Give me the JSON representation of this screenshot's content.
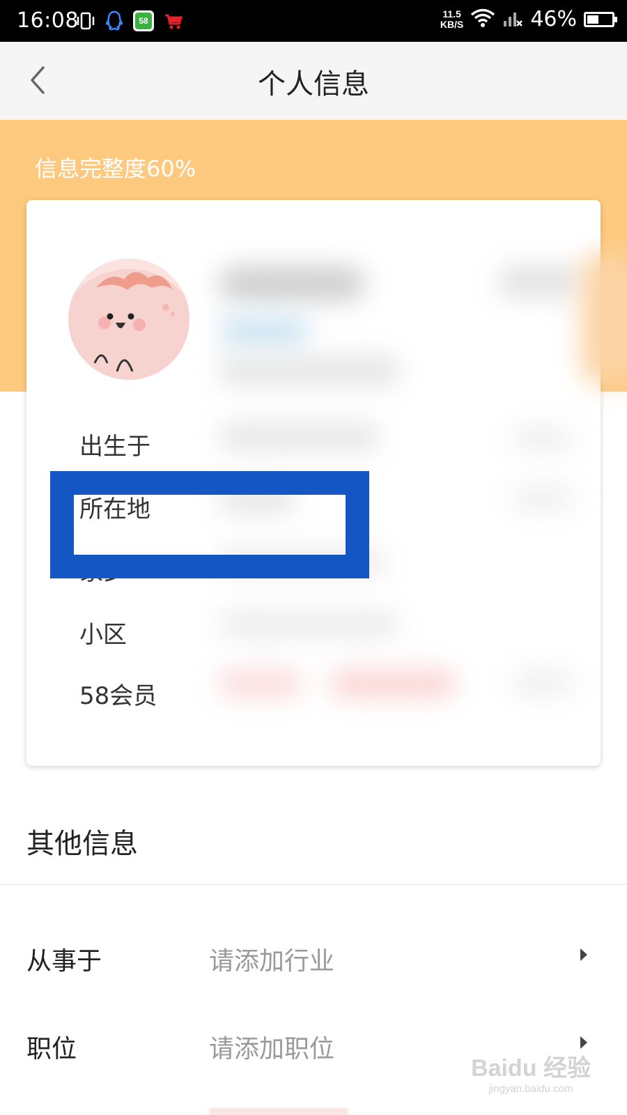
{
  "status_bar": {
    "time": "16:08",
    "net_speed_value": "11.5",
    "net_speed_unit": "KB/S",
    "battery": "46%",
    "battery_level": 0.46,
    "icons": [
      "vibrate-icon",
      "qq-icon",
      "app-58-icon",
      "cart-icon",
      "wifi-icon",
      "signal-icon",
      "battery-icon"
    ]
  },
  "header": {
    "title": "个人信息",
    "back_icon": "chevron-left-icon"
  },
  "banner": {
    "completeness": "信息完整度60%",
    "color": "#fdc97f"
  },
  "profile_card": {
    "labels": [
      "出生于",
      "所在地",
      "家乡",
      "小区",
      "58会员"
    ]
  },
  "highlight": {
    "color": "#1456c4"
  },
  "other_info": {
    "title": "其他信息",
    "rows": [
      {
        "label": "从事于",
        "value": "请添加行业"
      },
      {
        "label": "职位",
        "value": "请添加职位"
      }
    ]
  },
  "watermark": {
    "brand": "Baidu 经验",
    "domain": "jingyan.baidu.com"
  }
}
